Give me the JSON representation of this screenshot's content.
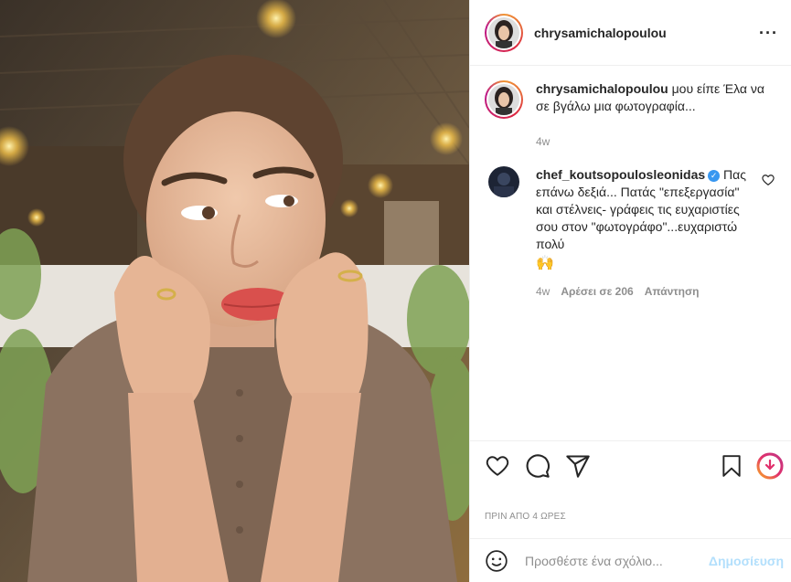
{
  "post": {
    "username": "chrysamichalopoulou",
    "more_label": "···"
  },
  "caption": {
    "username": "chrysamichalopoulou",
    "text": "μου είπε Έλα να σε βγάλω μια φωτογραφία...",
    "age": "4w"
  },
  "comment": {
    "username": "chef_koutsopoulosleonidas",
    "verified_mark": "✓",
    "text": "Πας επάνω δεξιά... Πατάς \"επεξεργασία\" και στέλνεις- γράφεις τις ευχαριστίες σου στον \"φωτογράφο\"...ευχαριστώ πολύ",
    "emoji": "🙌",
    "age": "4w",
    "likes": "Αρέσει σε 206",
    "reply": "Απάντηση"
  },
  "timestamp": "ΠΡΙΝ ΑΠΟ 4 ΩΡΕΣ",
  "add_comment": {
    "placeholder": "Προσθέστε ένα σχόλιο...",
    "post_label": "Δημοσίευση"
  },
  "icons": {
    "like": "heart-icon",
    "comment": "comment-icon",
    "share": "share-icon",
    "save": "bookmark-icon",
    "emoji": "emoji-icon",
    "story": "story-ring-icon"
  },
  "colors": {
    "link_blue": "#3897f0",
    "post_disabled": "#b2dffc",
    "meta_gray": "#8e8e8e"
  }
}
